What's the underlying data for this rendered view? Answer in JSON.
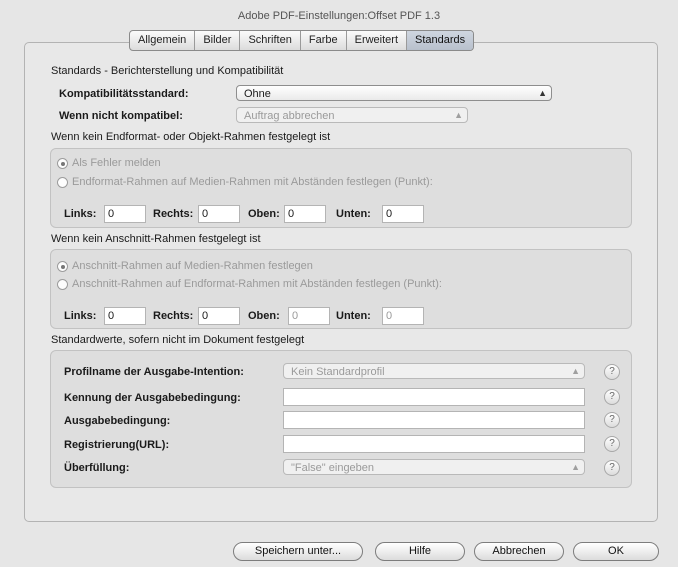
{
  "window": {
    "title": "Adobe PDF-Einstellungen:Offset PDF 1.3"
  },
  "tabs": [
    "Allgemein",
    "Bilder",
    "Schriften",
    "Farbe",
    "Erweitert",
    "Standards"
  ],
  "section_title": "Standards - Berichterstellung und Kompatibilität",
  "compat": {
    "label": "Kompatibilitätsstandard:",
    "value": "Ohne",
    "noncompat_label": "Wenn nicht kompatibel:",
    "noncompat_value": "Auftrag abbrechen"
  },
  "trimbox": {
    "title": "Wenn kein Endformat- oder Objekt-Rahmen festgelegt ist",
    "option1": "Als Fehler melden",
    "option2": "Endformat-Rahmen auf Medien-Rahmen mit Abständen festlegen (Punkt):",
    "links_label": "Links:",
    "links": "0",
    "rechts_label": "Rechts:",
    "rechts": "0",
    "oben_label": "Oben:",
    "oben": "0",
    "unten_label": "Unten:",
    "unten": "0"
  },
  "bleedbox": {
    "title": "Wenn kein Anschnitt-Rahmen festgelegt ist",
    "option1": "Anschnitt-Rahmen auf Medien-Rahmen festlegen",
    "option2": "Anschnitt-Rahmen auf Endformat-Rahmen mit Abständen festlegen (Punkt):",
    "links_label": "Links:",
    "links": "0",
    "rechts_label": "Rechts:",
    "rechts": "0",
    "oben_label": "Oben:",
    "oben": "0",
    "unten_label": "Unten:",
    "unten": "0"
  },
  "defaults": {
    "title": "Standardwerte, sofern nicht im Dokument festgelegt",
    "profile_label": "Profilname der Ausgabe-Intention:",
    "profile_value": "Kein Standardprofil",
    "id_label": "Kennung der Ausgabebedingung:",
    "condition_label": "Ausgabebedingung:",
    "registry_label": "Registrierung(URL):",
    "trapped_label": "Überfüllung:",
    "trapped_value": "\"False\" eingeben",
    "help": "?"
  },
  "buttons": {
    "save": "Speichern unter...",
    "help": "Hilfe",
    "cancel": "Abbrechen",
    "ok": "OK"
  }
}
